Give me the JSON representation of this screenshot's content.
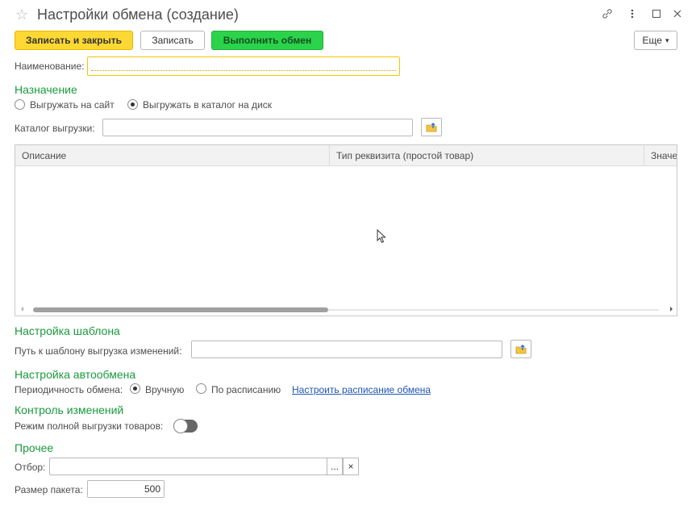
{
  "window": {
    "title": "Настройки обмена (создание)"
  },
  "toolbar": {
    "save_close_label": "Записать и закрыть",
    "save_label": "Записать",
    "run_label": "Выполнить обмен",
    "more_label": "Еще",
    "more_arrow": "▾"
  },
  "form": {
    "name_label": "Наименование:",
    "name_value": "",
    "destination_section": "Назначение",
    "dest_option_site": "Выгружать на сайт",
    "dest_option_disk": "Выгружать в каталог на диск",
    "dest_selected": "disk",
    "catalog_label": "Каталог выгрузки:",
    "catalog_value": ""
  },
  "table": {
    "columns": [
      "Описание",
      "Тип реквизита (простой товар)",
      "Значе"
    ],
    "rows": []
  },
  "template_section": {
    "title": "Настройка шаблона",
    "path_label": "Путь к шаблону выгрузка изменений:",
    "path_value": ""
  },
  "autoexchange": {
    "title": "Настройка автообмена",
    "period_label": "Периодичность обмена:",
    "option_manual": "Вручную",
    "option_schedule": "По расписанию",
    "selected": "manual",
    "schedule_link": "Настроить расписание обмена"
  },
  "changes": {
    "title": "Контроль изменений",
    "full_mode_label": "Режим полной выгрузки товаров:",
    "full_mode_on": false
  },
  "other": {
    "title": "Прочее",
    "filter_label": "Отбор:",
    "filter_value": "",
    "filter_select_label": "...",
    "filter_clear_label": "×",
    "batch_label": "Размер пакета:",
    "batch_value": "500"
  },
  "colors": {
    "accent_green": "#1a9a3d",
    "button_yellow": "#fdd833",
    "button_green": "#2bd34b",
    "link_blue": "#1f56b2"
  }
}
